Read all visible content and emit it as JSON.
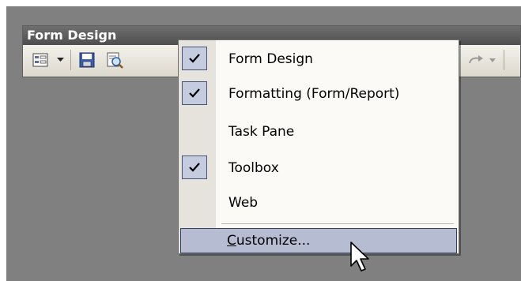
{
  "toolbar": {
    "title": "Form Design",
    "buttons": [
      {
        "icon": "form-view-icon"
      },
      {
        "icon": "dropdown-arrow-icon"
      },
      {
        "icon": "save-icon"
      },
      {
        "icon": "print-preview-icon"
      },
      {
        "icon": "redo-icon"
      },
      {
        "icon": "dropdown-arrow-icon"
      }
    ]
  },
  "menu": {
    "items": [
      {
        "label": "Form Design",
        "checked": true
      },
      {
        "label": "Formatting (Form/Report)",
        "checked": true
      },
      {
        "label": "Task Pane",
        "checked": false
      },
      {
        "label": "Toolbox",
        "checked": true
      },
      {
        "label": "Web",
        "checked": false
      }
    ],
    "customize": {
      "label_prefix": "C",
      "label_rest": "ustomize..."
    }
  },
  "colors": {
    "workspace": "#808080",
    "menu_highlight": "#b6bdd2",
    "check_bg": "#c5ccdf"
  }
}
